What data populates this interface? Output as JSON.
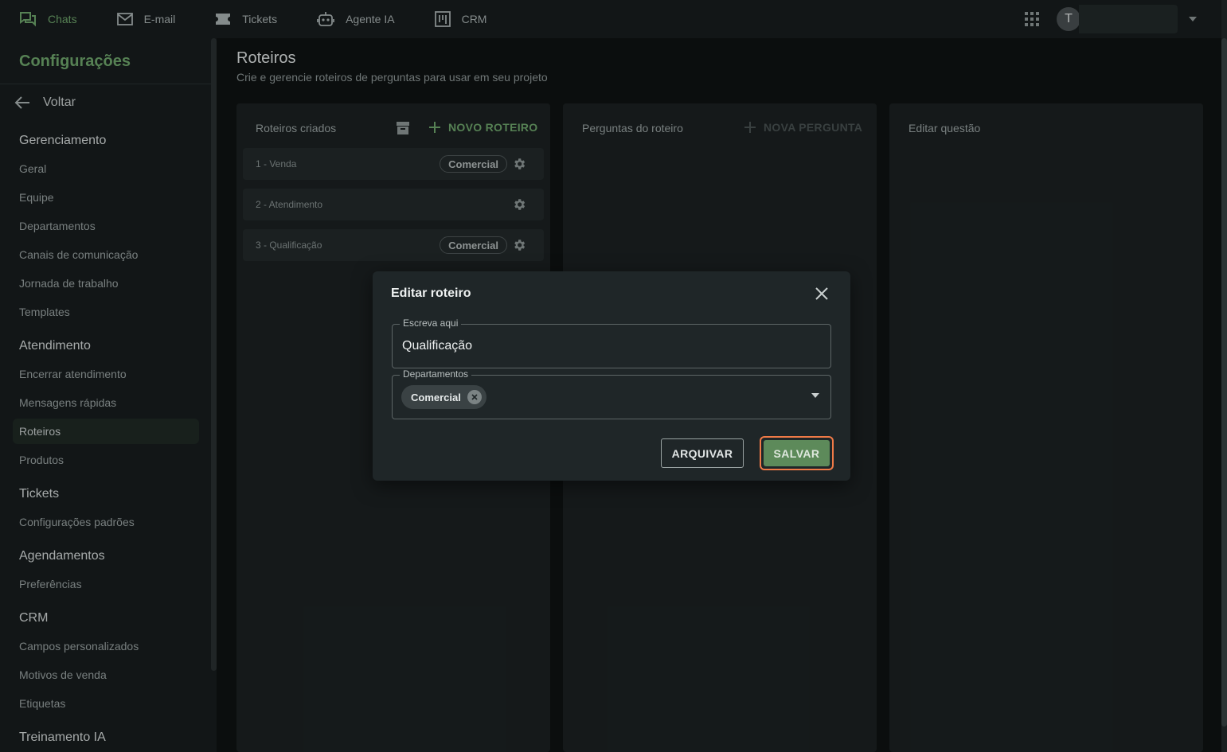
{
  "topnav": {
    "items": [
      {
        "label": "Chats",
        "icon": "chat-bubbles-icon",
        "active": true
      },
      {
        "label": "E-mail",
        "icon": "mail-icon"
      },
      {
        "label": "Tickets",
        "icon": "ticket-icon"
      },
      {
        "label": "Agente IA",
        "icon": "robot-icon"
      },
      {
        "label": "CRM",
        "icon": "kanban-icon"
      }
    ],
    "avatar_initial": "T"
  },
  "sidebar": {
    "title": "Configurações",
    "back_label": "Voltar",
    "groups": [
      {
        "label": "Gerenciamento",
        "items": [
          "Geral",
          "Equipe",
          "Departamentos",
          "Canais de comunicação",
          "Jornada de trabalho",
          "Templates"
        ]
      },
      {
        "label": "Atendimento",
        "items": [
          "Encerrar atendimento",
          "Mensagens rápidas",
          "Roteiros",
          "Produtos"
        ]
      },
      {
        "label": "Tickets",
        "items": [
          "Configurações padrões"
        ]
      },
      {
        "label": "Agendamentos",
        "items": [
          "Preferências"
        ]
      },
      {
        "label": "CRM",
        "items": [
          "Campos personalizados",
          "Motivos de venda",
          "Etiquetas"
        ]
      },
      {
        "label": "Treinamento IA",
        "items": []
      }
    ],
    "active_item": "Roteiros"
  },
  "main": {
    "title": "Roteiros",
    "subtitle": "Crie e gerencie roteiros de perguntas para usar em seu projeto",
    "panels": {
      "scripts": {
        "title": "Roteiros criados",
        "new_label": "NOVO ROTEIRO",
        "rows": [
          {
            "name": "1 - Venda",
            "tag": "Comercial"
          },
          {
            "name": "2 - Atendimento",
            "tag": ""
          },
          {
            "name": "3 - Qualificação",
            "tag": "Comercial"
          }
        ]
      },
      "questions": {
        "title": "Perguntas do roteiro",
        "new_label": "NOVA PERGUNTA"
      },
      "edit": {
        "title": "Editar questão"
      }
    }
  },
  "dialog": {
    "title": "Editar roteiro",
    "name_field": {
      "label": "Escreva aqui",
      "value": "Qualificação"
    },
    "dept_field": {
      "label": "Departamentos",
      "selected": "Comercial"
    },
    "archive_label": "ARQUIVAR",
    "save_label": "SALVAR"
  },
  "colors": {
    "accent": "#6fa66c",
    "save_button": "#5d8a5a",
    "focus_outline": "#f07a47"
  }
}
